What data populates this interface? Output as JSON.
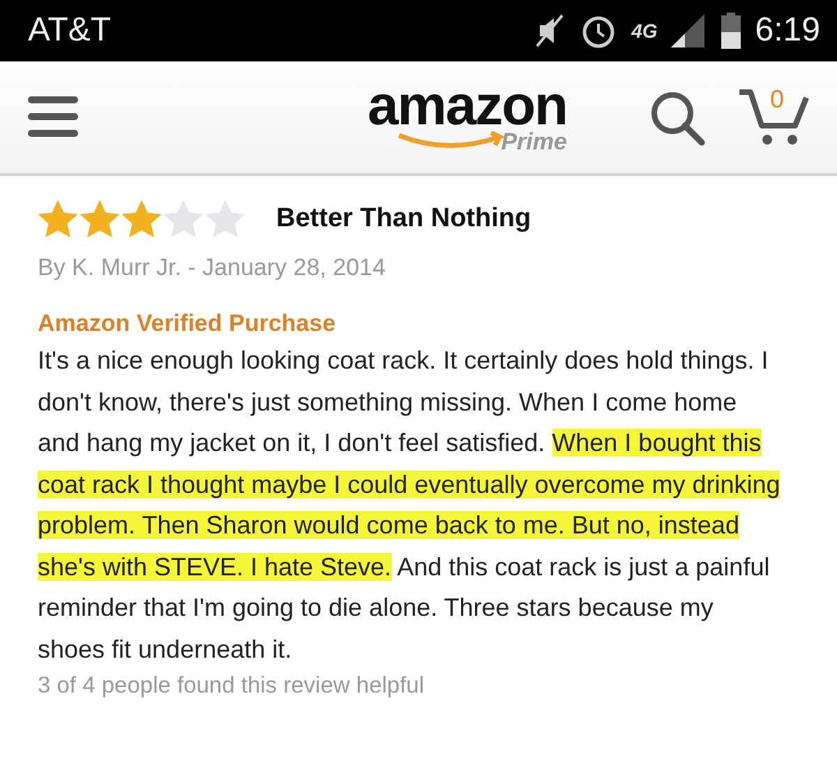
{
  "status_bar": {
    "carrier": "AT&T",
    "network": "4G",
    "time": "6:19"
  },
  "header": {
    "logo": "amazon",
    "logo_sub": "Prime",
    "cart_count": "0"
  },
  "review": {
    "stars": 3,
    "title": "Better Than Nothing",
    "byline": "By K. Murr Jr. - January 28, 2014",
    "badge": "Amazon Verified Purchase",
    "body": [
      {
        "text": "It's a nice enough looking coat rack. It certainly does hold things. I don't know, there's just something missing. When I come home and hang my jacket on it, I don't feel satisfied. ",
        "highlighted": false
      },
      {
        "text": "When I bought this coat rack I thought maybe I could eventually overcome my drinking problem. Then Sharon would come back to me. But no, instead she's with STEVE. I hate Steve.",
        "highlighted": true
      },
      {
        "text": " And this coat rack is just a painful reminder that I'm going to die alone. Three stars because my shoes fit underneath it.",
        "highlighted": false
      }
    ],
    "helpful": "3 of 4 people found this review helpful"
  }
}
